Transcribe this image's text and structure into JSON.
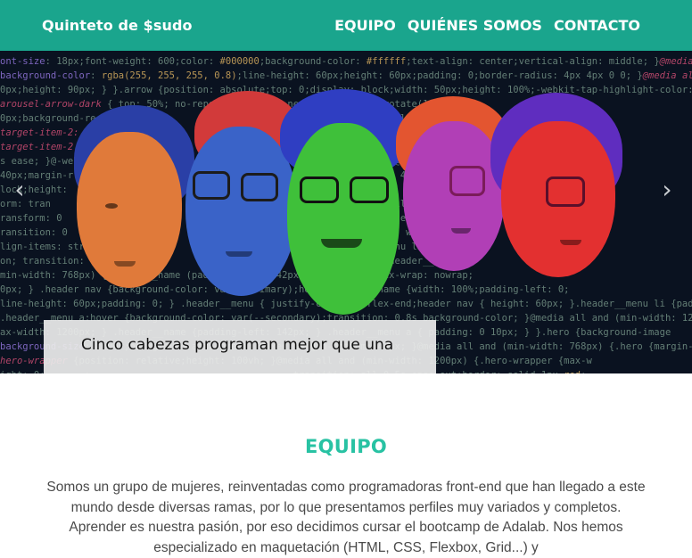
{
  "header": {
    "brand": "Quinteto de $sudo",
    "nav": [
      {
        "label": "EQUIPO"
      },
      {
        "label": "QUIÉNES SOMOS"
      },
      {
        "label": "CONTACTO"
      }
    ],
    "bg_color": "#1aa58d"
  },
  "hero": {
    "caption": "Cinco cabezas programan mejor que una",
    "prev_icon": "chevron-left-icon",
    "next_icon": "chevron-right-icon",
    "heads": [
      {
        "color": "orange"
      },
      {
        "color": "blue"
      },
      {
        "color": "green"
      },
      {
        "color": "magenta"
      },
      {
        "color": "red"
      }
    ]
  },
  "team": {
    "title": "EQUIPO",
    "title_color": "#28c2a3",
    "description": "Somos un grupo de mujeres, reinventadas como programadoras front-end que han llegado a este mundo desde diversas ramas, por lo que presentamos perfiles muy variados y completos. Aprender es nuestra pasión, por eso decidimos cursar el bootcamp de Adalab. Nos hemos especializado en maquetación (HTML, CSS, Flexbox, Grid...) y"
  }
}
